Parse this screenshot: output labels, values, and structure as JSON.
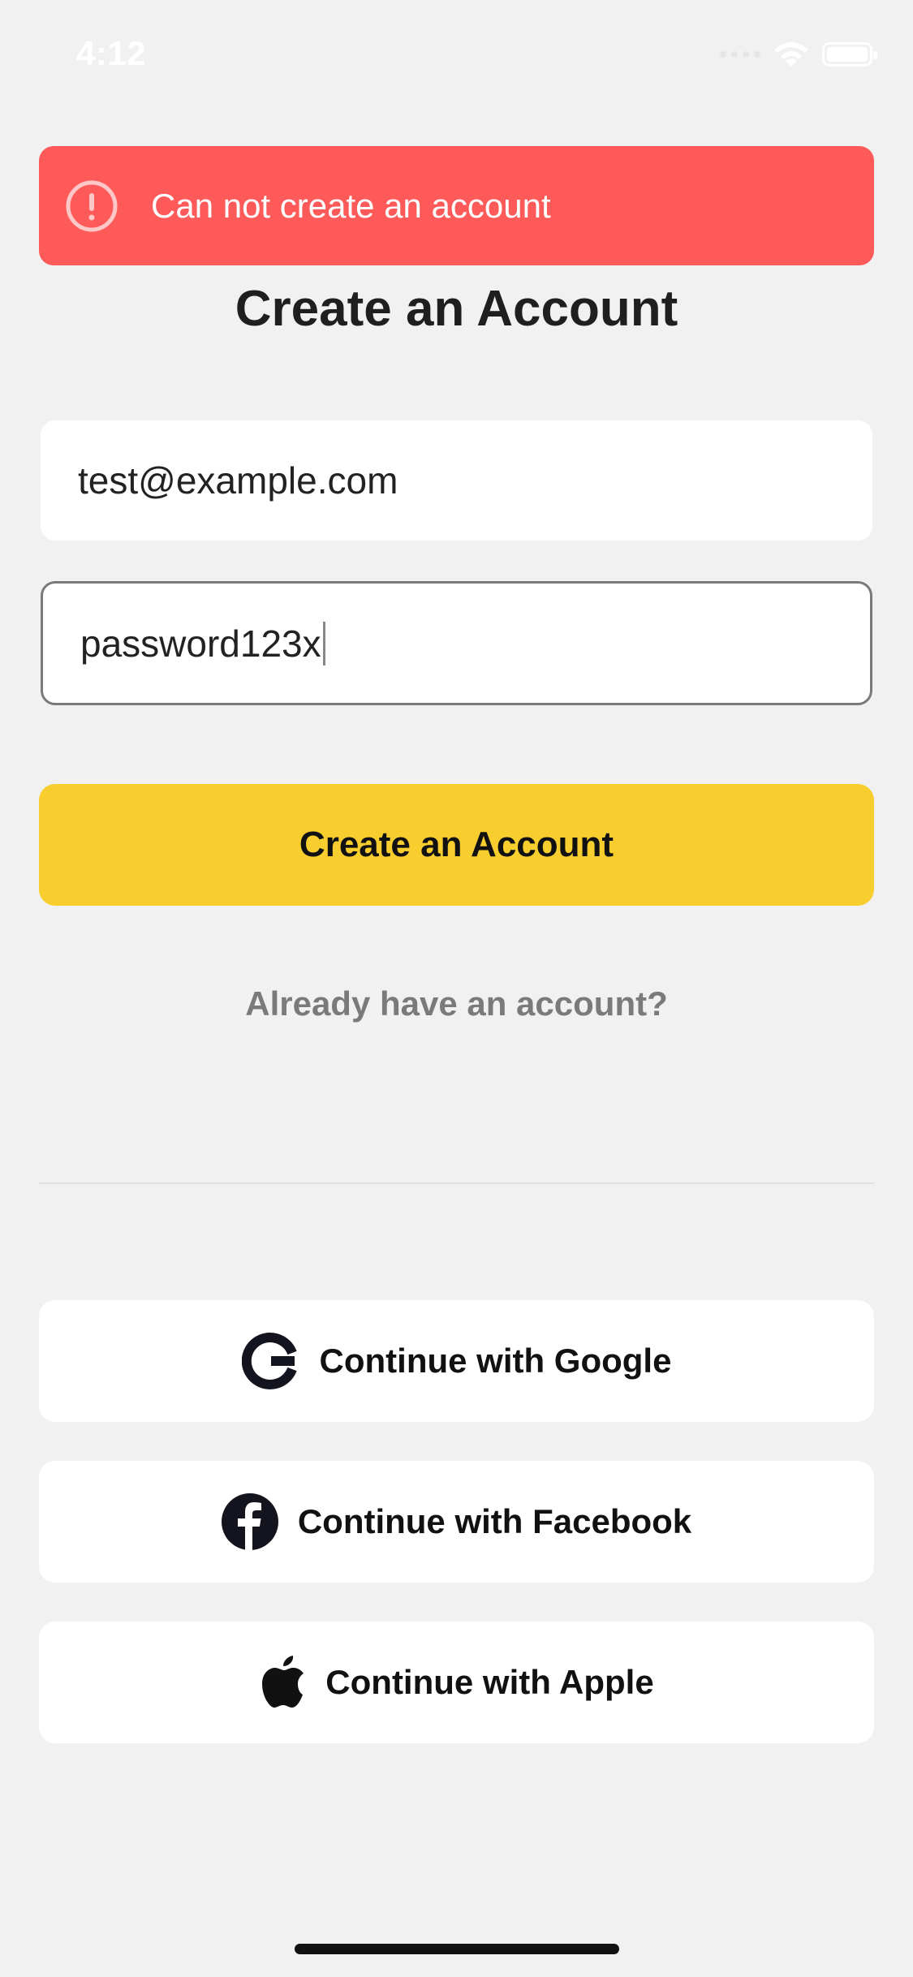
{
  "status_bar": {
    "time": "4:12"
  },
  "error_banner": {
    "message": "Can not create an account",
    "icon": "alert-circle-icon",
    "color": "#ff5a5a"
  },
  "title": "Create an Account",
  "form": {
    "email_value": "test@example.com",
    "password_value": "password123x"
  },
  "primary_button": {
    "label": "Create an Account",
    "color": "#f8cd2e"
  },
  "signin_link": "Already have an account?",
  "social": {
    "google_label": "Continue with Google",
    "facebook_label": "Continue with Facebook",
    "apple_label": "Continue with Apple"
  }
}
